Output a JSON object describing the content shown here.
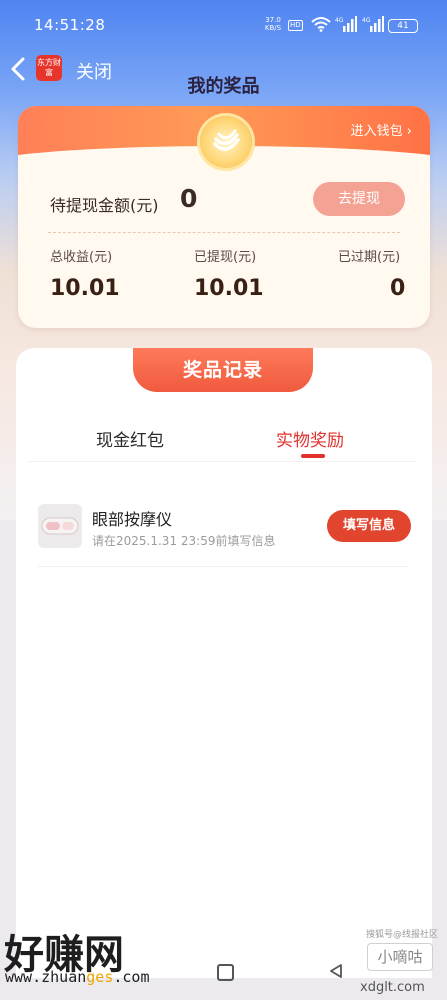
{
  "status_bar": {
    "time": "14:51:28",
    "net_speed": "37.0",
    "net_speed_unit": "KB/S",
    "hd_badge": "HD",
    "signal1": "4G",
    "signal2": "4G",
    "battery": "41"
  },
  "nav": {
    "back_icon": "chevron-left-icon",
    "app_logo_text": "东方财富",
    "close_label": "关闭",
    "title": "我的奖品"
  },
  "summary": {
    "wallet_link": "进入钱包 ›",
    "pending_label": "待提现金额(元)",
    "pending_value": "0",
    "withdraw_button": "去提现",
    "stats": [
      {
        "label": "总收益(元)",
        "value": "10.01"
      },
      {
        "label": "已提现(元)",
        "value": "10.01"
      },
      {
        "label": "已过期(元)",
        "value": "0"
      }
    ],
    "colors": {
      "header": "#ff8a56",
      "button": "#f4a293"
    }
  },
  "records": {
    "header": "奖品记录",
    "tabs": [
      {
        "label": "现金红包",
        "active": false
      },
      {
        "label": "实物奖励",
        "active": true
      }
    ],
    "items": [
      {
        "thumb_icon": "eye-massager-image",
        "name": "眼部按摩仪",
        "deadline": "请在2025.1.31 23:59前填写信息",
        "action": "填写信息"
      }
    ],
    "colors": {
      "accent": "#e3322d"
    }
  },
  "system_nav": {
    "home_icon": "square-home-icon",
    "back_icon": "triangle-back-icon"
  },
  "watermark": {
    "left_big": "好赚网",
    "left_url_part1": "www.zhuan",
    "left_url_part2": "ges",
    "left_url_part3": ".com",
    "right_top": "搜狐号@线报社区",
    "right_badge": "小嘀咕",
    "right_url": "xdglt.com"
  }
}
